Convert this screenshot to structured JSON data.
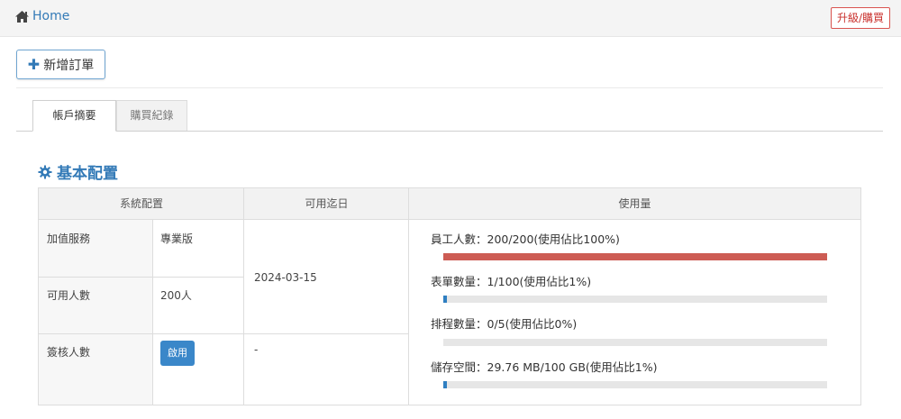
{
  "topbar": {
    "home_label": "Home",
    "upgrade_label": "升級/購買"
  },
  "toolbar": {
    "new_order_label": "新增訂單"
  },
  "tabs": [
    {
      "label": "帳戶摘要",
      "active": true
    },
    {
      "label": "購買紀錄",
      "active": false
    }
  ],
  "section": {
    "title": "基本配置"
  },
  "table": {
    "headers": [
      "系統配置",
      "可用迄日",
      "使用量"
    ],
    "rows": [
      {
        "label": "加值服務",
        "value": "專業版"
      },
      {
        "label": "可用人數",
        "value": "200人"
      },
      {
        "label": "簽核人數",
        "button": "啟用"
      }
    ],
    "expiry_date": "2024-03-15",
    "expiry_dash": "-"
  },
  "usage": [
    {
      "label": "員工人數：200/200(使用佔比100%)",
      "percent": 100,
      "color": "#cd5c54"
    },
    {
      "label": "表單數量：1/100(使用佔比1%)",
      "percent": 1,
      "color": "#2f7fc1"
    },
    {
      "label": "排程數量：0/5(使用佔比0%)",
      "percent": 0,
      "color": "#2f7fc1"
    },
    {
      "label": "儲存空間：29.76 MB/100 GB(使用佔比1%)",
      "percent": 1,
      "color": "#2f7fc1"
    }
  ],
  "colors": {
    "accent": "#337ab7",
    "danger": "#d9534f"
  }
}
